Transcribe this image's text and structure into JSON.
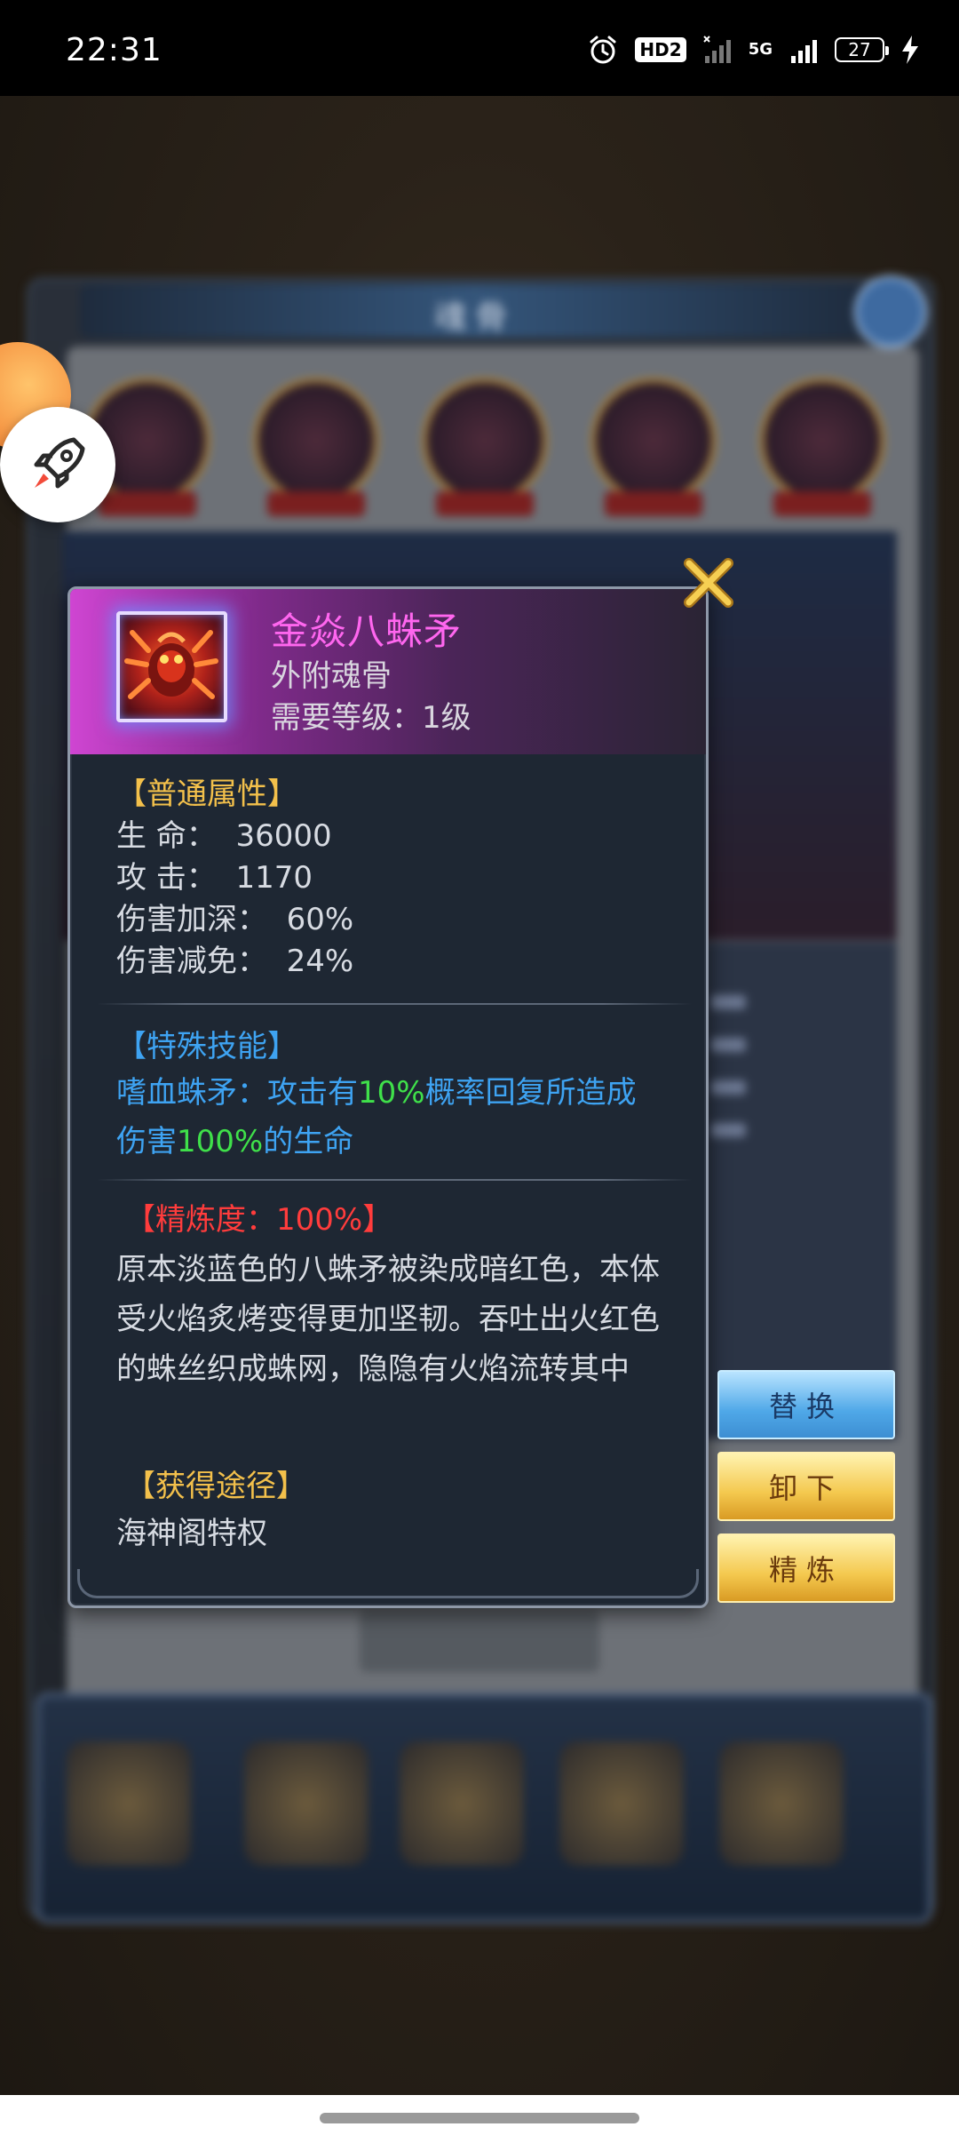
{
  "status_bar": {
    "time": "22:31",
    "icons": [
      "alarm-icon",
      "hd-icon",
      "wifi-signal-icon",
      "cellular-signal-icon",
      "battery-icon",
      "charging-icon"
    ],
    "hd_label": "HD2",
    "network_label": "5G",
    "battery_level": "27"
  },
  "background": {
    "window_title": "魂骨",
    "colors": {
      "panel": "#2b3340",
      "title_bar": "#34557a",
      "nav": "#233146"
    }
  },
  "tooltip": {
    "item": {
      "name": "金焱八蛛矛",
      "type": "外附魂骨",
      "requirement": "需要等级：1级",
      "icon": "spider-spear-icon"
    },
    "common_attributes": {
      "title": "【普通属性】",
      "stats": [
        {
          "label": "生 命：",
          "value": "36000"
        },
        {
          "label": "攻 击：",
          "value": "1170"
        },
        {
          "label": "伤害加深：",
          "value": "60%"
        },
        {
          "label": "伤害减免：",
          "value": "24%"
        }
      ]
    },
    "special_skill": {
      "title": "【特殊技能】",
      "part1": "嗜血蛛矛：攻击有",
      "highlight1": "10%",
      "part2": "概率回复所造成",
      "part3": "伤害",
      "highlight2": "100%",
      "part4": "的生命"
    },
    "refinement": {
      "title": "【精炼度：100%】",
      "description": "原本淡蓝色的八蛛矛被染成暗红色，本体受火焰炙烤变得更加坚韧。吞吐出火红色的蛛丝织成蛛网，隐隐有火焰流转其中"
    },
    "obtain": {
      "title": "【获得途径】",
      "source": "海神阁特权"
    }
  },
  "actions": {
    "replace": "替换",
    "unequip": "卸下",
    "refine": "精炼"
  },
  "colors": {
    "item_name": "#ff66ef",
    "section_gold": "#f3c04b",
    "section_blue": "#3ea3f2",
    "section_red": "#ff3c3c",
    "highlight_green": "#3fe04a",
    "btn_blue": "#4fa8e8",
    "btn_gold": "#f4c84e"
  }
}
